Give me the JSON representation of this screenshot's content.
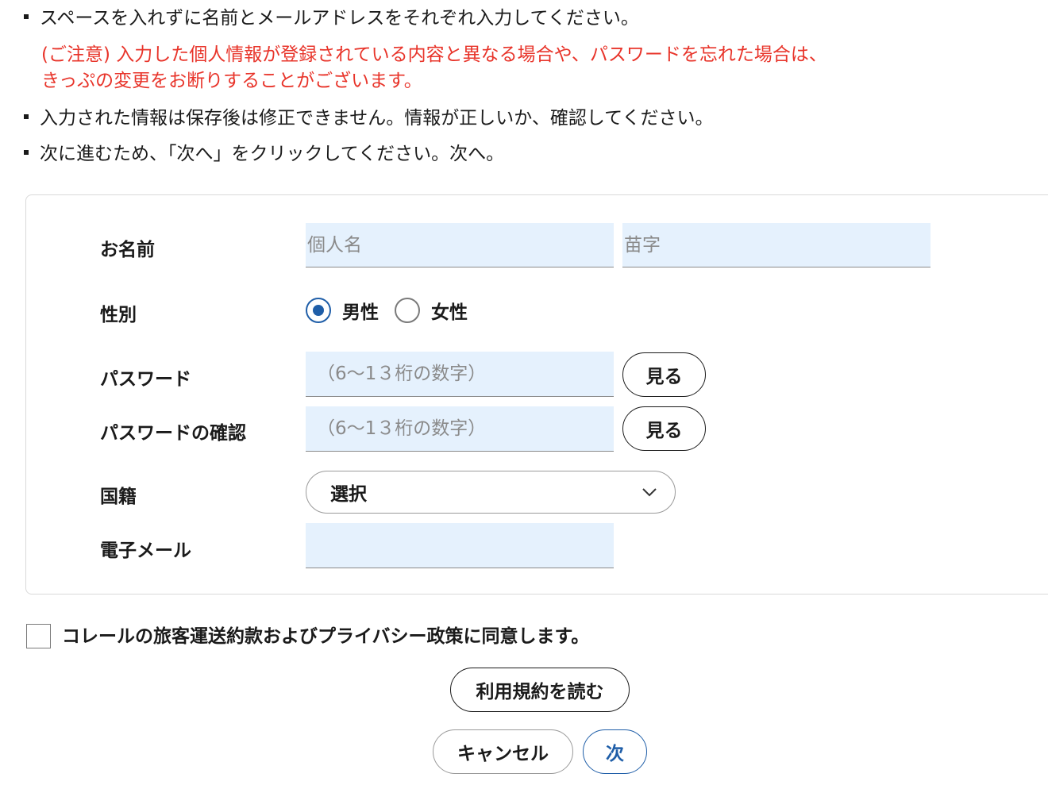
{
  "instructions": {
    "line1": "スペースを入れずに名前とメールアドレスをそれぞれ入力してください。",
    "caution_line1": "(ご注意) 入力した個人情報が登録されている内容と異なる場合や、パスワードを忘れた場合は、",
    "caution_line2": "きっぷの変更をお断りすることがございます。",
    "line2": "入力された情報は保存後は修正できません。情報が正しいか、確認してください。",
    "line3": "次に進むため、「次へ」をクリックしてください。次へ。"
  },
  "form": {
    "name_label": "お名前",
    "first_name_placeholder": "個人名",
    "last_name_placeholder": "苗字",
    "gender_label": "性別",
    "gender_options": [
      "男性",
      "女性"
    ],
    "gender_selected": "男性",
    "password_label": "パスワード",
    "password_placeholder": "（6～1３桁の数字）",
    "password_confirm_label": "パスワードの確認",
    "password_confirm_placeholder": "（6～1３桁の数字）",
    "show_label": "見る",
    "nationality_label": "国籍",
    "nationality_value": "選択",
    "email_label": "電子メール",
    "email_value": ""
  },
  "agreement": {
    "checked": false,
    "text": "コレールの旅客運送約款およびプライバシー政策に同意します。"
  },
  "buttons": {
    "read_terms": "利用規約を読む",
    "cancel": "キャンセル",
    "next": "次"
  },
  "colors": {
    "caution": "#e8342a",
    "input_bg": "#e5f1fd",
    "accent": "#1f5ea8"
  },
  "icons": {
    "select_arrow": "chevron-down-icon"
  }
}
